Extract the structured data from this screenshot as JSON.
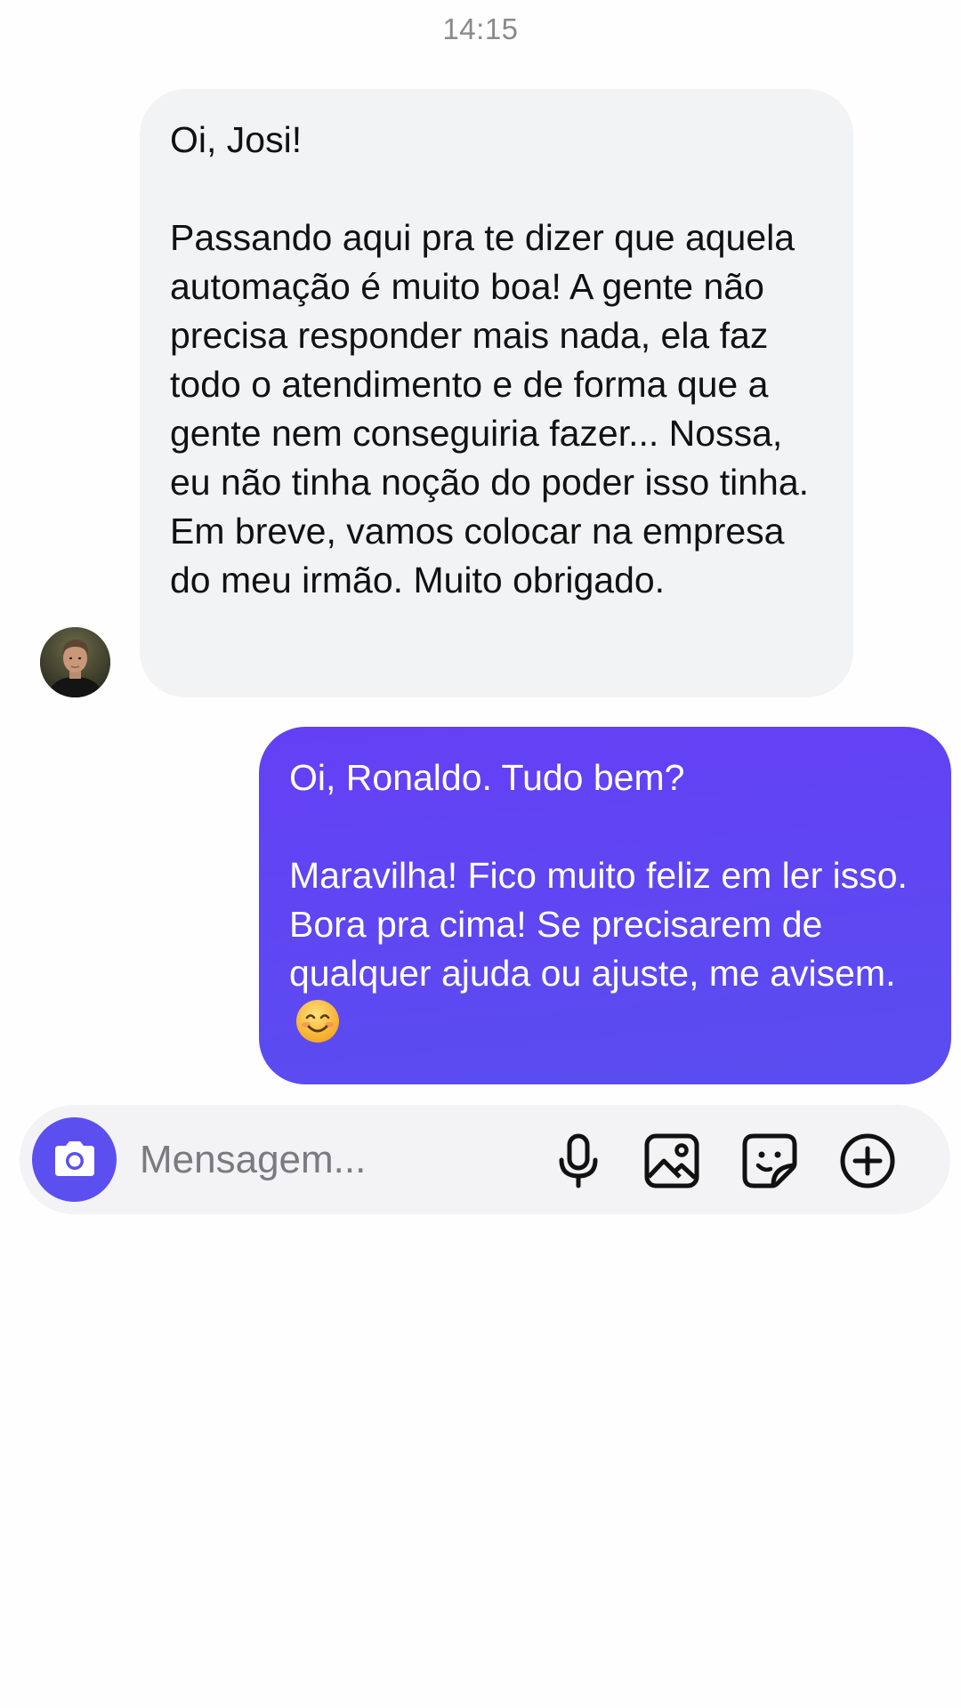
{
  "header": {
    "time": "14:15"
  },
  "messages": [
    {
      "direction": "incoming",
      "paragraphs": [
        "Oi, Josi!",
        "Passando aqui pra te dizer que aquela automação é muito boa! A gente não precisa responder mais nada, ela faz todo o atendimento e de forma que a gente nem conseguiria fazer... Nossa, eu não tinha noção do poder isso tinha. Em breve, vamos colocar na empresa do meu irmão. Muito obrigado."
      ]
    },
    {
      "direction": "outgoing",
      "paragraphs": [
        "Oi, Ronaldo. Tudo bem?",
        "Maravilha! Fico muito feliz em ler isso. Bora pra cima! Se precisarem de qualquer ajuda ou ajuste, me avisem."
      ],
      "emoji": "smiling-face-with-smiling-eyes"
    }
  ],
  "composer": {
    "placeholder": "Mensagem...",
    "value": "",
    "icons": [
      "camera-icon",
      "microphone-icon",
      "image-icon",
      "sticker-icon",
      "plus-circle-icon"
    ]
  },
  "colors": {
    "outgoing_bubble": "#5b47f2",
    "incoming_bubble": "#f2f3f5",
    "accent": "#5b4ff0",
    "timestamp": "#8a8a8e"
  }
}
